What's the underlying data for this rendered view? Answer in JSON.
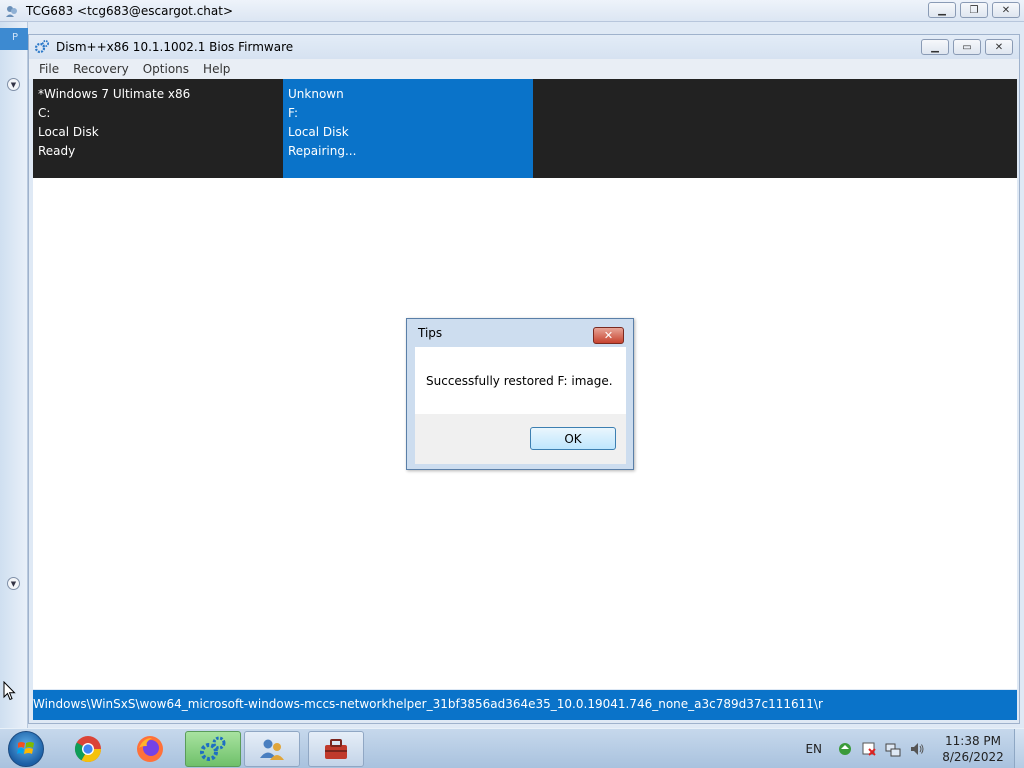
{
  "outer_window": {
    "title": "TCG683 <tcg683@escargot.chat>",
    "icon": "messenger-icon",
    "left_tab_text": "P"
  },
  "dism_window": {
    "title": "Dism++x86 10.1.1002.1 Bios Firmware",
    "icon": "gears-icon",
    "menu": [
      "File",
      "Recovery",
      "Options",
      "Help"
    ],
    "drives": [
      {
        "name": "*Windows 7 Ultimate x86",
        "letter": "C:",
        "type": "Local Disk",
        "status": "Ready"
      },
      {
        "name": "Unknown",
        "letter": "F:",
        "type": "Local Disk",
        "status": "Repairing..."
      }
    ],
    "status_path": "Windows\\WinSxS\\wow64_microsoft-windows-mccs-networkhelper_31bf3856ad364e35_10.0.19041.746_none_a3c789d37c111611\\r"
  },
  "dialog": {
    "title": "Tips",
    "message": "Successfully restored F: image.",
    "ok_label": "OK",
    "close_symbol": "✕"
  },
  "taskbar": {
    "language": "EN",
    "time": "11:38 PM",
    "date": "8/26/2022",
    "apps": [
      "chrome-icon",
      "firefox-icon",
      "dism-gears-icon",
      "messenger-users-icon",
      "toolbox-icon"
    ]
  },
  "colors": {
    "accent": "#0a73c9",
    "drive_panel": "#222222"
  }
}
